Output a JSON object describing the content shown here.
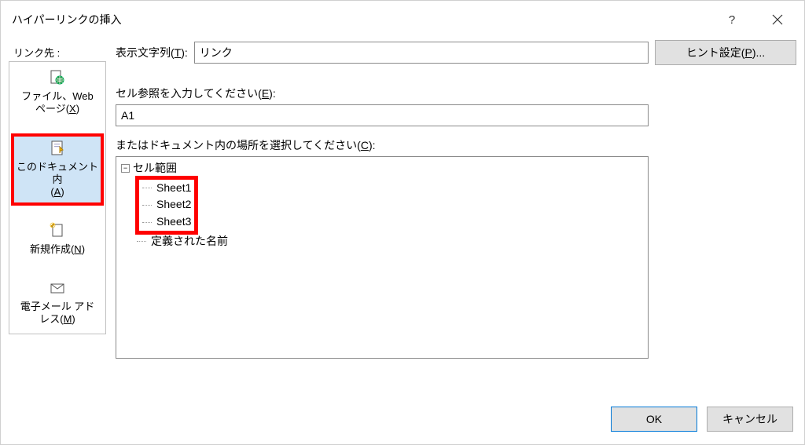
{
  "title": "ハイパーリンクの挿入",
  "titlebar": {
    "help_tooltip": "?",
    "close_tooltip": "閉じる"
  },
  "sidebar": {
    "header": "リンク先 :",
    "items": [
      {
        "line1": "ファイル、Web",
        "line2_pre": "ページ(",
        "line2_key": "X",
        "line2_post": ")"
      },
      {
        "line1": "このドキュメント内",
        "line2_pre": "(",
        "line2_key": "A",
        "line2_post": ")"
      },
      {
        "line1_pre": "新規作成(",
        "line1_key": "N",
        "line1_post": ")"
      },
      {
        "line1": "電子メール アド",
        "line2_pre": "レス(",
        "line2_key": "M",
        "line2_post": ")"
      }
    ]
  },
  "content": {
    "display_text_label_pre": "表示文字列(",
    "display_text_label_key": "T",
    "display_text_label_post": "):",
    "display_text_value": "リンク",
    "hint_button_pre": "ヒント設定(",
    "hint_button_key": "P",
    "hint_button_post": ")...",
    "cell_ref_label_pre": "セル参照を入力してください(",
    "cell_ref_label_key": "E",
    "cell_ref_label_post": "):",
    "cell_ref_value": "A1",
    "place_label_pre": "またはドキュメント内の場所を選択してください(",
    "place_label_key": "C",
    "place_label_post": "):",
    "tree": {
      "root": "セル範囲",
      "sheets": [
        "Sheet1",
        "Sheet2",
        "Sheet3"
      ],
      "defined_names": "定義された名前"
    }
  },
  "footer": {
    "ok": "OK",
    "cancel": "キャンセル"
  }
}
